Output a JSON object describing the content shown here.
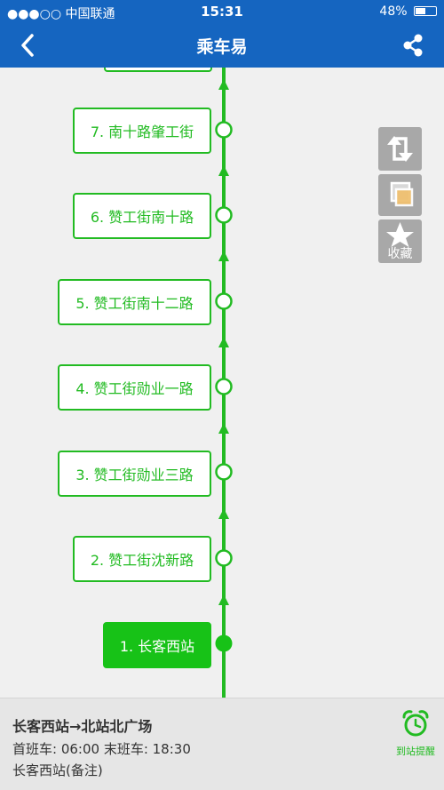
{
  "status_bar": {
    "carrier": "●●●○○ 中国联通",
    "time": "15:31",
    "battery": "48%",
    "battery_level": 0.48
  },
  "nav": {
    "title": "乘车易",
    "back_icon": "chevron-left-icon",
    "share_icon": "share-icon"
  },
  "route": {
    "stops": [
      {
        "label": "7.  南十路肇工街"
      },
      {
        "label": "6.  赞工街南十路"
      },
      {
        "label": "5.  赞工街南十二路"
      },
      {
        "label": "4.  赞工街勋业一路"
      },
      {
        "label": "3.  赞工街勋业三路"
      },
      {
        "label": "2.  赞工街沈新路"
      },
      {
        "label": "1.  长客西站",
        "current": true
      }
    ],
    "line_color": "#22bb22"
  },
  "side_buttons": {
    "swap_icon": "swap-direction-icon",
    "layers_icon": "layers-icon",
    "favorite_icon": "star-icon",
    "favorite_label": "收藏"
  },
  "bottom": {
    "route_title": "长客西站→北站北广场",
    "times": "首班车:  06:00 末班车:  18:30",
    "note": "长客西站(备注)",
    "alarm_icon": "alarm-clock-icon",
    "alarm_label": "到站提醒"
  }
}
